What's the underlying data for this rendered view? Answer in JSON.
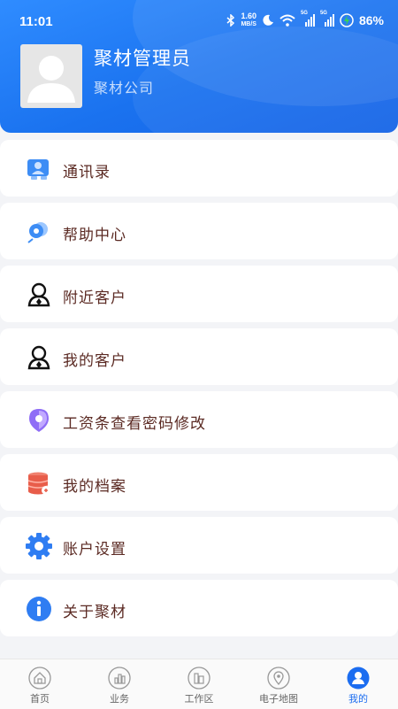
{
  "status_bar": {
    "time": "11:01",
    "speed_value": "1.60",
    "speed_unit": "MB/S",
    "signal1_label": "5G",
    "signal2_label": "5G",
    "battery": "86%"
  },
  "profile": {
    "name": "聚材管理员",
    "company": "聚材公司"
  },
  "menu": {
    "items": [
      {
        "label": "通讯录",
        "icon": "contacts-icon"
      },
      {
        "label": "帮助中心",
        "icon": "help-center-icon"
      },
      {
        "label": "附近客户",
        "icon": "nearby-customer-icon"
      },
      {
        "label": "我的客户",
        "icon": "my-customer-icon"
      },
      {
        "label": "工资条查看密码修改",
        "icon": "payslip-password-icon"
      },
      {
        "label": "我的档案",
        "icon": "archive-icon"
      },
      {
        "label": "账户设置",
        "icon": "gear-icon"
      },
      {
        "label": "关于聚材",
        "icon": "info-icon"
      }
    ]
  },
  "tabbar": {
    "tabs": [
      {
        "label": "首页",
        "icon": "home-icon"
      },
      {
        "label": "业务",
        "icon": "business-icon"
      },
      {
        "label": "工作区",
        "icon": "workspace-icon"
      },
      {
        "label": "电子地图",
        "icon": "map-pin-icon"
      },
      {
        "label": "我的",
        "icon": "user-icon"
      }
    ],
    "active_index": 4
  },
  "colors": {
    "header_blue": "#1a72ef",
    "tab_active": "#1c6df0",
    "menu_text": "#5b2a23"
  }
}
